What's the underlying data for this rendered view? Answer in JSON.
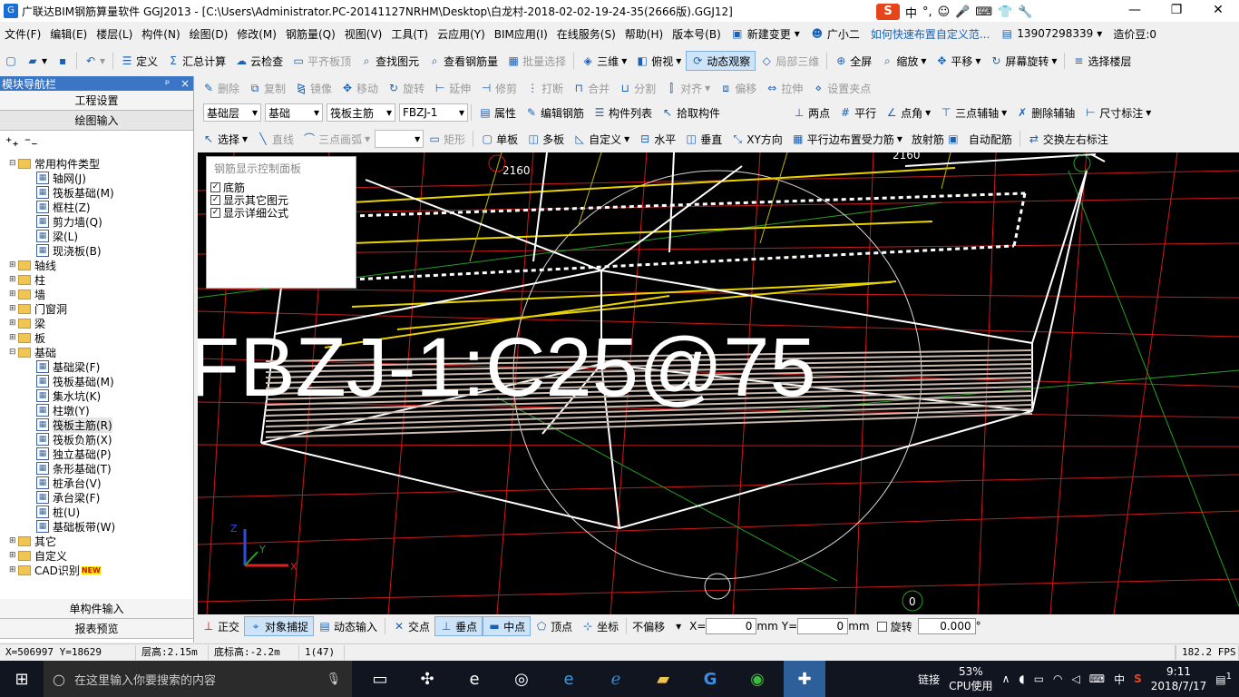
{
  "window": {
    "title": "广联达BIM钢筋算量软件 GGJ2013 - [C:\\Users\\Administrator.PC-20141127NRHM\\Desktop\\白龙村-2018-02-02-19-24-35(2666版).GGJ12]",
    "ime": [
      "中",
      "°,",
      "☺",
      "🎤",
      "⌨",
      "👕",
      "🔧"
    ],
    "controls": [
      "—",
      "❐",
      "✕"
    ]
  },
  "menu": {
    "items": [
      "文件(F)",
      "编辑(E)",
      "楼层(L)",
      "构件(N)",
      "绘图(D)",
      "修改(M)",
      "钢筋量(Q)",
      "视图(V)",
      "工具(T)",
      "云应用(Y)",
      "BIM应用(I)",
      "在线服务(S)",
      "帮助(H)",
      "版本号(B)"
    ],
    "new_change": "新建变更",
    "assistant": "广小二",
    "tip": "如何快速布置自定义范...",
    "phone": "13907298339",
    "cost_bean": "造价豆:0"
  },
  "toolbar1": {
    "items": [
      "定义",
      "汇总计算",
      "云检查",
      "平齐板顶",
      "查找图元",
      "查看钢筋量",
      "批量选择",
      "三维",
      "俯视",
      "动态观察",
      "局部三维",
      "全屏",
      "缩放",
      "平移",
      "屏幕旋转",
      "选择楼层"
    ]
  },
  "toolbar2": {
    "items": [
      "删除",
      "复制",
      "镜像",
      "移动",
      "旋转",
      "延伸",
      "修剪",
      "打断",
      "合并",
      "分割",
      "对齐",
      "偏移",
      "拉伸",
      "设置夹点"
    ]
  },
  "toolbar3": {
    "floor": "基础层",
    "category": "基础",
    "type": "筏板主筋",
    "component": "FBZJ-1",
    "items": [
      "属性",
      "编辑钢筋",
      "构件列表",
      "拾取构件",
      "两点",
      "平行",
      "点角",
      "三点辅轴",
      "删除辅轴",
      "尺寸标注"
    ]
  },
  "toolbar4": {
    "items": [
      "选择",
      "直线",
      "三点画弧",
      "矩形",
      "单板",
      "多板",
      "自定义",
      "水平",
      "垂直",
      "XY方向",
      "平行边布置受力筋",
      "放射筋",
      "自动配筋",
      "交换左右标注"
    ]
  },
  "nav": {
    "title": "模块导航栏",
    "pin": "ᵖ",
    "close": "×",
    "sections": [
      "工程设置",
      "绘图输入"
    ],
    "tree": [
      {
        "level": 0,
        "exp": "⊟",
        "label": "常用构件类型",
        "kind": "folder"
      },
      {
        "level": 1,
        "label": "轴网(J)",
        "kind": "comp"
      },
      {
        "level": 1,
        "label": "筏板基础(M)",
        "kind": "comp"
      },
      {
        "level": 1,
        "label": "框柱(Z)",
        "kind": "comp"
      },
      {
        "level": 1,
        "label": "剪力墙(Q)",
        "kind": "comp"
      },
      {
        "level": 1,
        "label": "梁(L)",
        "kind": "comp"
      },
      {
        "level": 1,
        "label": "现浇板(B)",
        "kind": "comp"
      },
      {
        "level": 0,
        "exp": "⊞",
        "label": "轴线",
        "kind": "folder"
      },
      {
        "level": 0,
        "exp": "⊞",
        "label": "柱",
        "kind": "folder"
      },
      {
        "level": 0,
        "exp": "⊞",
        "label": "墙",
        "kind": "folder"
      },
      {
        "level": 0,
        "exp": "⊞",
        "label": "门窗洞",
        "kind": "folder"
      },
      {
        "level": 0,
        "exp": "⊞",
        "label": "梁",
        "kind": "folder"
      },
      {
        "level": 0,
        "exp": "⊞",
        "label": "板",
        "kind": "folder"
      },
      {
        "level": 0,
        "exp": "⊟",
        "label": "基础",
        "kind": "folder"
      },
      {
        "level": 1,
        "label": "基础梁(F)",
        "kind": "comp"
      },
      {
        "level": 1,
        "label": "筏板基础(M)",
        "kind": "comp"
      },
      {
        "level": 1,
        "label": "集水坑(K)",
        "kind": "comp"
      },
      {
        "level": 1,
        "label": "柱墩(Y)",
        "kind": "comp"
      },
      {
        "level": 1,
        "label": "筏板主筋(R)",
        "kind": "comp",
        "selected": true
      },
      {
        "level": 1,
        "label": "筏板负筋(X)",
        "kind": "comp"
      },
      {
        "level": 1,
        "label": "独立基础(P)",
        "kind": "comp"
      },
      {
        "level": 1,
        "label": "条形基础(T)",
        "kind": "comp"
      },
      {
        "level": 1,
        "label": "桩承台(V)",
        "kind": "comp"
      },
      {
        "level": 1,
        "label": "承台梁(F)",
        "kind": "comp"
      },
      {
        "level": 1,
        "label": "桩(U)",
        "kind": "comp"
      },
      {
        "level": 1,
        "label": "基础板带(W)",
        "kind": "comp"
      },
      {
        "level": 0,
        "exp": "⊞",
        "label": "其它",
        "kind": "folder"
      },
      {
        "level": 0,
        "exp": "⊞",
        "label": "自定义",
        "kind": "folder"
      },
      {
        "level": 0,
        "exp": "⊞",
        "label": "CAD识别",
        "kind": "folder",
        "new": "NEW"
      }
    ],
    "bottom": [
      "单构件输入",
      "报表预览"
    ]
  },
  "rebar_panel": {
    "title": "钢筋显示控制面板",
    "options": [
      {
        "label": "底筋",
        "checked": true
      },
      {
        "label": "显示其它图元",
        "checked": true
      },
      {
        "label": "显示详细公式",
        "checked": true
      }
    ]
  },
  "viewport": {
    "rebar_label": "FBZJ-1:C25@75",
    "dim_left": "2160",
    "dim_right": "2160",
    "axis_marker": "0",
    "axes": [
      "Z",
      "Y",
      "X"
    ]
  },
  "snapbar": {
    "items": [
      "正交",
      "对象捕捉",
      "动态输入",
      "交点",
      "垂点",
      "中点",
      "顶点",
      "坐标"
    ],
    "offset_mode": "不偏移",
    "x_label": "X=",
    "x_value": "0",
    "y_label": "Y=",
    "y_value": "0",
    "unit": "mm",
    "rotate_label": "旋转",
    "rotate_value": "0.000",
    "deg": "°"
  },
  "status": {
    "coords": "X=506997 Y=18629",
    "floor_height": "层高:2.15m",
    "base_height": "底标高:-2.2m",
    "count": "1(47)",
    "fps": "182.2 FPS"
  },
  "taskbar": {
    "search_placeholder": "在这里输入你要搜索的内容",
    "link": "链接",
    "cpu_pct": "53%",
    "cpu_label": "CPU使用",
    "lang": "中",
    "time": "9:11",
    "date": "2018/7/17",
    "notif": "1"
  },
  "colors": {
    "accent": "#3b76c6",
    "viewport_bg": "#000000",
    "grid_red": "#d01818",
    "rebar_white": "#ffffff",
    "rebar_yellow": "#f0e000"
  }
}
